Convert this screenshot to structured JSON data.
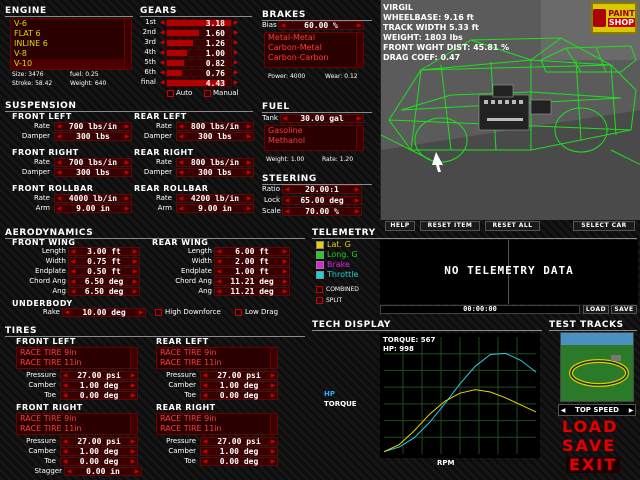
{
  "engine": {
    "title": "Engine",
    "options": [
      "V-6",
      "FLAT 6",
      "INLINE 6",
      "V-8",
      "V-10"
    ],
    "selected_index": 4,
    "size_label": "Size:",
    "size_value": "3476",
    "fuel_label": "fuel:",
    "fuel_value": "0.25",
    "stroke_label": "Stroke:",
    "stroke_value": "58.42",
    "weight_label": "Weight:",
    "weight_value": "640"
  },
  "gears": {
    "title": "Gears",
    "rows": [
      {
        "label": "1st",
        "value": "3.18",
        "fill": 1.0
      },
      {
        "label": "2nd",
        "value": "1.60",
        "fill": 0.5
      },
      {
        "label": "3rd",
        "value": "1.26",
        "fill": 0.4
      },
      {
        "label": "4th",
        "value": "1.00",
        "fill": 0.32
      },
      {
        "label": "5th",
        "value": "0.82",
        "fill": 0.26
      },
      {
        "label": "6th",
        "value": "0.76",
        "fill": 0.24
      },
      {
        "label": "final",
        "value": "4.43",
        "fill": 0.9
      }
    ],
    "auto_label": "Auto",
    "manual_label": "Manual"
  },
  "brakes": {
    "title": "Brakes",
    "bias_label": "Bias",
    "bias_value": "60.00 %",
    "options": [
      "Metal-Metal",
      "Carbon-Metal",
      "Carbon-Carbon"
    ],
    "power_label": "Power:",
    "power_value": "4000",
    "wear_label": "Wear:",
    "wear_value": "0.12"
  },
  "viewport": {
    "lines": [
      "VIRGIL",
      "WHEELBASE: 9.16 ft",
      "TRACK WIDTH 5.33 ft",
      "WEIGHT: 1803 lbs",
      "FRONT WGHT DIST: 45.81 %",
      "DRAG COEF: 0.47"
    ],
    "paint_label_1": "PAINT",
    "paint_label_2": "SHOP",
    "buttons": [
      "HELP",
      "RESET ITEM",
      "RESET ALL",
      "SELECT CAR"
    ]
  },
  "suspension": {
    "title": "Suspension",
    "front_left": {
      "title": "Front Left",
      "rate_label": "Rate",
      "rate": "700 lbs/in",
      "damper_label": "Damper",
      "damper": "300 lbs"
    },
    "rear_left": {
      "title": "Rear Left",
      "rate_label": "Rate",
      "rate": "800 lbs/in",
      "damper_label": "Damper",
      "damper": "300 lbs"
    },
    "front_right": {
      "title": "Front Right",
      "rate_label": "Rate",
      "rate": "700 lbs/in",
      "damper_label": "Damper",
      "damper": "300 lbs"
    },
    "rear_right": {
      "title": "Rear Right",
      "rate_label": "Rate",
      "rate": "800 lbs/in",
      "damper_label": "Damper",
      "damper": "300 lbs"
    },
    "front_rollbar": {
      "title": "Front Rollbar",
      "rate_label": "Rate",
      "rate": "4000 lb/in",
      "arm_label": "Arm",
      "arm": "9.00 in"
    },
    "rear_rollbar": {
      "title": "Rear Rollbar",
      "rate_label": "Rate",
      "rate": "4200 lb/in",
      "arm_label": "Arm",
      "arm": "9.00 in"
    }
  },
  "fuel": {
    "title": "Fuel",
    "tank_label": "Tank",
    "tank_value": "30.00 gal",
    "options": [
      "Gasoline",
      "Methanol"
    ],
    "weight_label": "Weight:",
    "weight_value": "1.00",
    "rate_label": "Rate:",
    "rate_value": "1.20"
  },
  "steering": {
    "title": "Steering",
    "ratio_label": "Ratio",
    "ratio_value": "20.00:1",
    "lock_label": "Lock",
    "lock_value": "65.00 deg",
    "scale_label": "Scale",
    "scale_value": "70.00 %"
  },
  "aero": {
    "title": "Aerodynamics",
    "front_wing": {
      "title": "Front Wing",
      "rows": [
        {
          "label": "Length",
          "value": "3.00 ft"
        },
        {
          "label": "Width",
          "value": "0.75 ft"
        },
        {
          "label": "Endplate",
          "value": "0.50 ft"
        },
        {
          "label": "Chord Ang",
          "value": "6.50 deg"
        },
        {
          "label": "Ang",
          "value": "6.50 deg"
        }
      ]
    },
    "rear_wing": {
      "title": "Rear Wing",
      "rows": [
        {
          "label": "Length",
          "value": "6.00 ft"
        },
        {
          "label": "Width",
          "value": "2.00 ft"
        },
        {
          "label": "Endplate",
          "value": "1.00 ft"
        },
        {
          "label": "Chord Ang",
          "value": "11.21 deg"
        },
        {
          "label": "Ang",
          "value": "11.21 deg"
        }
      ]
    },
    "underbody_title": "Underbody",
    "rake_label": "Rake",
    "rake_value": "10.00 deg",
    "high_downforce_label": "High Downforce",
    "low_drag_label": "Low Drag"
  },
  "telemetry": {
    "title": "Telemetry",
    "channels": [
      {
        "label": "Lat. G",
        "color": "#e8d000"
      },
      {
        "label": "Long. G",
        "color": "#20d020"
      },
      {
        "label": "Brake",
        "color": "#e020e0"
      },
      {
        "label": "Throttle",
        "color": "#20d0d0"
      }
    ],
    "combined_label": "COMBINED",
    "split_label": "SPLIT",
    "no_data": "NO TELEMETRY DATA",
    "time": "00:00:00",
    "load_label": "LOAD",
    "save_label": "SAVE"
  },
  "tires": {
    "title": "Tires",
    "front_left": {
      "title": "Front Left",
      "options": [
        "RACE TIRE 9in",
        "RACE TIRE 11in"
      ],
      "pressure": "27.00 psi",
      "camber": "1.00 deg",
      "toe": "0.00 deg"
    },
    "rear_left": {
      "title": "Rear Left",
      "options": [
        "RACE TIRE 9in",
        "RACE TIRE 11in"
      ],
      "pressure": "27.00 psi",
      "camber": "1.00 deg",
      "toe": "0.00 deg"
    },
    "front_right": {
      "title": "Front Right",
      "options": [
        "RACE TIRE 9in",
        "RACE TIRE 11in"
      ],
      "pressure": "27.00 psi",
      "camber": "1.00 deg",
      "toe": "0.00 deg"
    },
    "rear_right": {
      "title": "Rear Right",
      "options": [
        "RACE TIRE 9in",
        "RACE TIRE 11in"
      ],
      "pressure": "27.00 psi",
      "camber": "1.00 deg",
      "toe": "0.00 deg"
    },
    "pressure_label": "Pressure",
    "camber_label": "Camber",
    "toe_label": "Toe",
    "stagger_label": "Stagger",
    "stagger_value": "0.00 in"
  },
  "tech": {
    "title": "Tech Display",
    "torque_text": "TORQUE: 567",
    "hp_text": "HP: 998",
    "hp_label": "HP",
    "torque_label": "TORQUE",
    "x_label": "RPM",
    "hp_color": "#30c8e0",
    "torque_color": "#e8d800"
  },
  "test_tracks": {
    "title": "Test Tracks",
    "selected": "TOP SPEED"
  },
  "actions": {
    "load": "LOAD",
    "save": "SAVE",
    "exit": "EXIT"
  },
  "chart_data": {
    "type": "line",
    "title": "",
    "xlabel": "RPM",
    "ylabel": "",
    "grid": true,
    "series": [
      {
        "name": "HP",
        "x": [
          0,
          1,
          2,
          3,
          4,
          5,
          6,
          7,
          8,
          9,
          10
        ],
        "values": [
          0.02,
          0.06,
          0.14,
          0.27,
          0.43,
          0.6,
          0.75,
          0.85,
          0.86,
          0.8,
          0.7
        ]
      },
      {
        "name": "TORQUE",
        "x": [
          0,
          1,
          2,
          3,
          4,
          5,
          6,
          7,
          8,
          9,
          10
        ],
        "values": [
          0.02,
          0.08,
          0.2,
          0.34,
          0.45,
          0.52,
          0.55,
          0.53,
          0.48,
          0.42,
          0.36
        ]
      }
    ],
    "xlim": [
      0,
      10
    ],
    "ylim": [
      0,
      1
    ]
  }
}
